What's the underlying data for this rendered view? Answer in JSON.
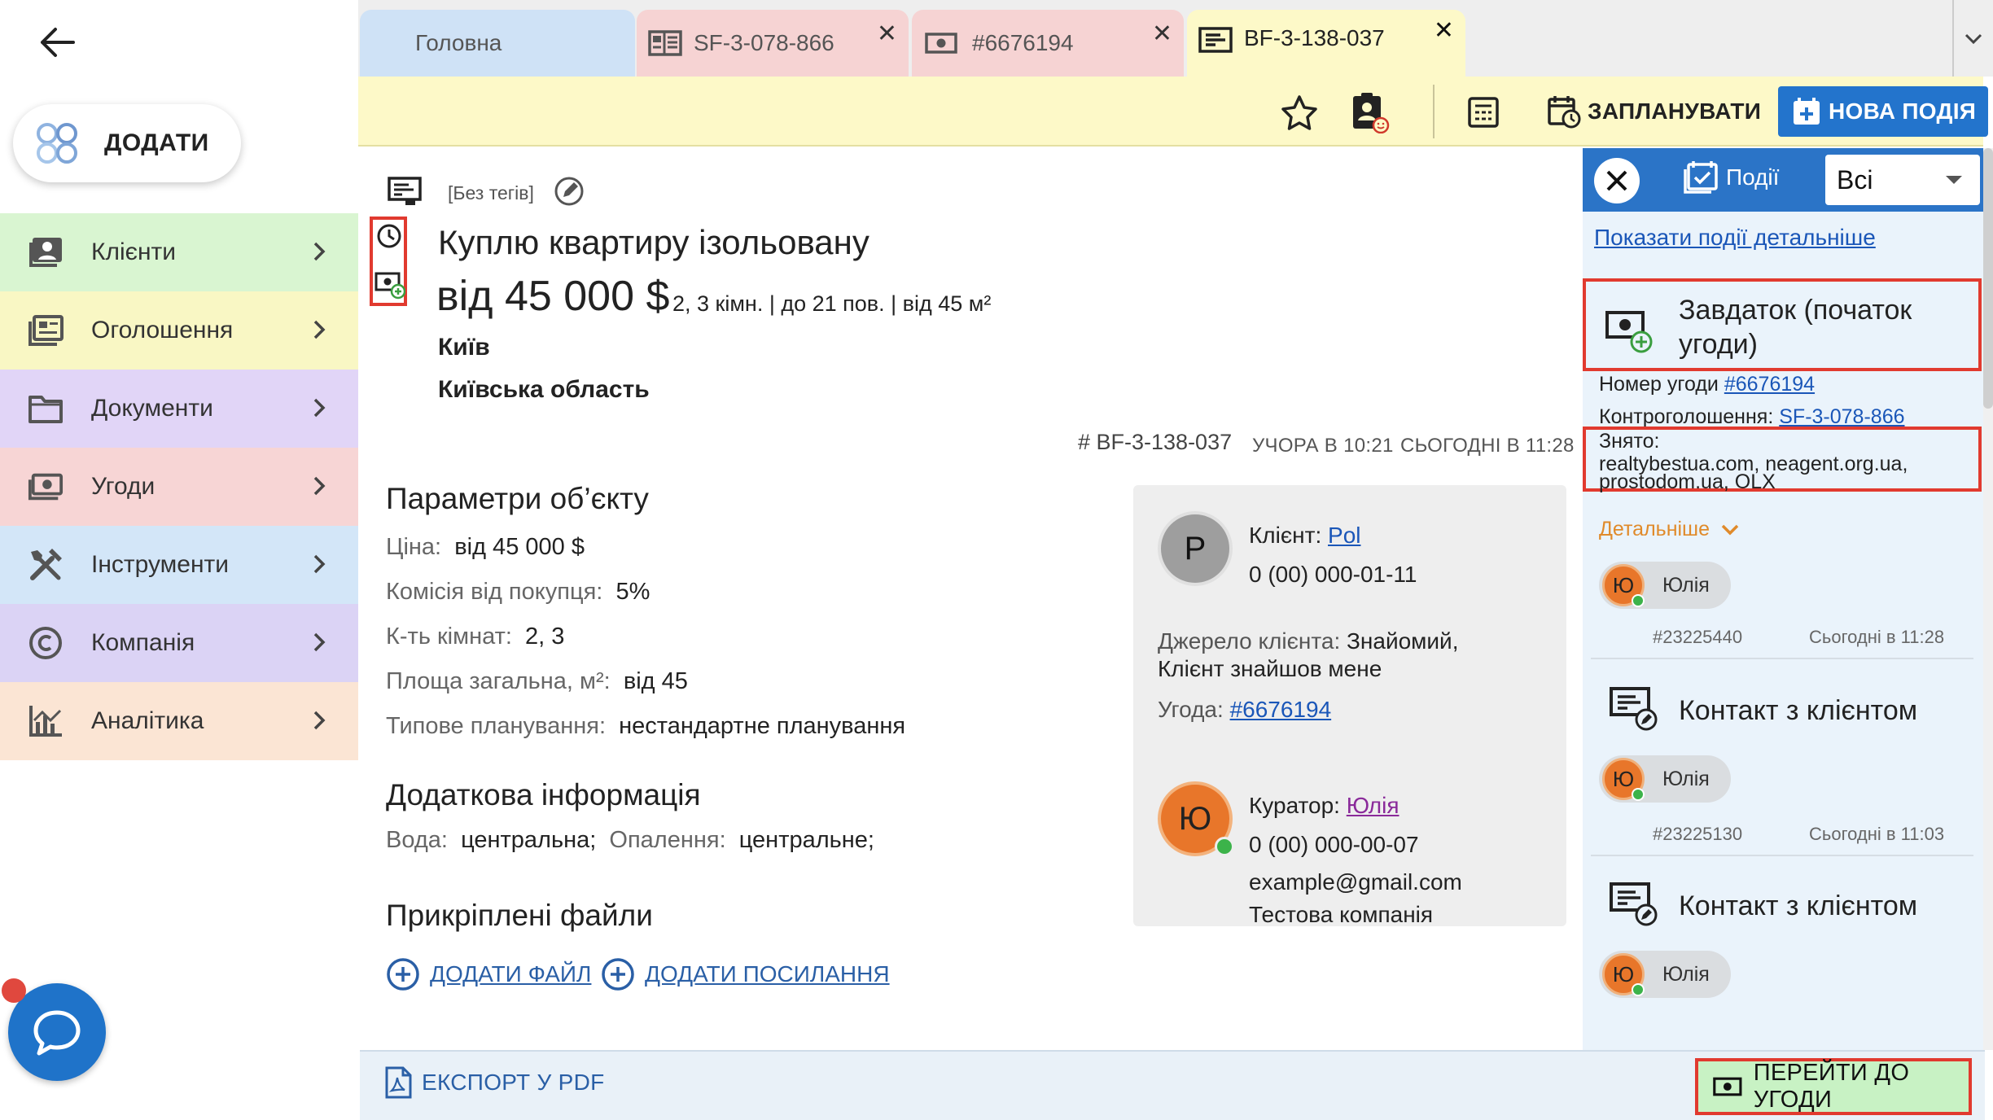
{
  "sidebar": {
    "add_label": "ДОДАТИ",
    "items": [
      {
        "label": "Клієнти",
        "color": "#d9f5d1"
      },
      {
        "label": "Оголошення",
        "color": "#f9f7c4"
      },
      {
        "label": "Документи",
        "color": "#e1d5f7"
      },
      {
        "label": "Угоди",
        "color": "#f7d5d5"
      },
      {
        "label": "Інструменти",
        "color": "#d3e6f8"
      },
      {
        "label": "Компанія",
        "color": "#dbd3f5"
      },
      {
        "label": "Аналітика",
        "color": "#fbe5d4"
      }
    ]
  },
  "tabs": [
    {
      "label": "Головна",
      "color": "#cfe2f6"
    },
    {
      "label": "SF-3-078-866",
      "color": "#f6d3d3"
    },
    {
      "label": "#6676194",
      "color": "#f6d3d3"
    },
    {
      "label": "BF-3-138-037",
      "color": "#fdf9c8"
    }
  ],
  "toolbar": {
    "plan_label": "ЗАПЛАНУВАТИ",
    "new_event_label": "НОВА ПОДІЯ"
  },
  "request": {
    "tags": "[Без тегів]",
    "title": "Куплю квартиру ізольовану",
    "price": "від 45 000 $",
    "specs": "2, 3 кімн. | до 21 пов. | від 45 м²",
    "city": "Київ",
    "region": "Київська область",
    "id": "# BF-3-138-037",
    "created": "УЧОРА В 10:21",
    "updated": "СЬОГОДНІ В 11:28"
  },
  "params": {
    "heading": "Параметри об’єкту",
    "rows": [
      {
        "label": "Ціна:",
        "value": "від 45 000 $"
      },
      {
        "label": "Комісія від покупця:",
        "value": "5%"
      },
      {
        "label": "К-ть кімнат:",
        "value": "2, 3"
      },
      {
        "label": "Площа загальна, м²:",
        "value": "від 45"
      },
      {
        "label": "Типове планування:",
        "value": "нестандартне планування"
      }
    ]
  },
  "extra": {
    "heading": "Додаткова інформація",
    "water_label": "Вода:",
    "water_value": "центральна;",
    "heat_label": "Опалення:",
    "heat_value": "центральне;"
  },
  "files": {
    "heading": "Прикріплені файли",
    "add_file": "ДОДАТИ ФАЙЛ",
    "add_link": "ДОДАТИ ПОСИЛАННЯ"
  },
  "client": {
    "avatar": "P",
    "label": "Клієнт:",
    "name": "Pol",
    "phone": "0 (00) 000-01-11",
    "source_label": "Джерело клієнта:",
    "source_value": "Знайомий,",
    "source_value2": "Клієнт знайшов мене",
    "deal_label": "Угода:",
    "deal": "#6676194"
  },
  "curator": {
    "avatar": "Ю",
    "label": "Куратор:",
    "name": "Юлія",
    "phone": "0 (00) 000-00-07",
    "email": "example@gmail.com",
    "company": "Тестова компанія"
  },
  "footer": {
    "export_label": "ЕКСПОРТ У PDF",
    "goto_deal_label": "ПЕРЕЙТИ ДО УГОДИ"
  },
  "events": {
    "tab_label": "Події",
    "filter_value": "Всі",
    "show_detailed": "Показати події детальніше",
    "first": {
      "title_line1": "Завдаток (початок",
      "title_line2": "угоди)",
      "deal_label": "Номер угоди",
      "deal_value": "#6676194",
      "control_label": "Контроголошення:",
      "control_value": "SF-3-078-866",
      "removed_label": "Знято:",
      "removed_line1": "realtybestua.com, neagent.org.ua,",
      "removed_line2": "prostodom.ua, OLX",
      "more_label": "Детальніше",
      "user_initial": "Ю",
      "user": "Юлія",
      "id": "#23225440",
      "time": "Сьогодні в 11:28"
    },
    "second": {
      "title": "Контакт з клієнтом",
      "user_initial": "Ю",
      "user": "Юлія",
      "id": "#23225130",
      "time": "Сьогодні в 11:03"
    },
    "third": {
      "title": "Контакт з клієнтом",
      "user_initial": "Ю",
      "user": "Юлія"
    }
  }
}
